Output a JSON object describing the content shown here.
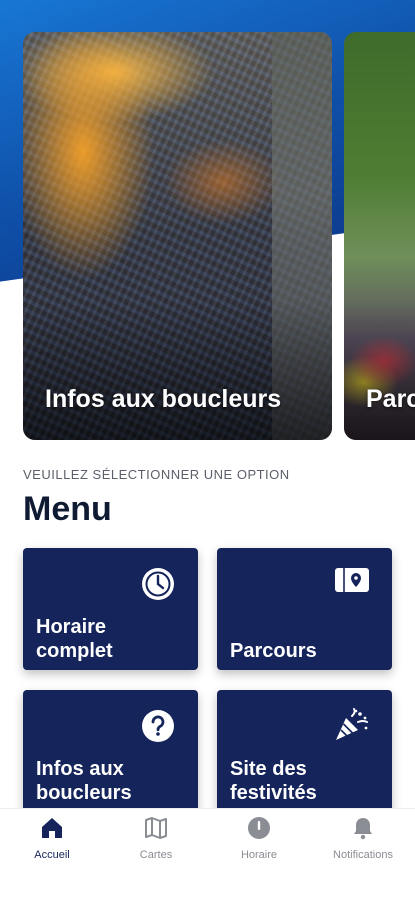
{
  "carousel": {
    "cards": [
      {
        "title": "Infos aux boucleurs"
      },
      {
        "title": "Parcours"
      }
    ]
  },
  "menu_section": {
    "subtitle": "VEUILLEZ SÉLECTIONNER UNE OPTION",
    "title": "Menu"
  },
  "tiles": [
    {
      "label": "Horaire complet",
      "icon": "clock-icon"
    },
    {
      "label": "Parcours",
      "icon": "map-pin-icon"
    },
    {
      "label": "Infos aux boucleurs",
      "icon": "question-icon"
    },
    {
      "label": "Site des festivités",
      "icon": "party-popper-icon"
    }
  ],
  "bottom_nav": {
    "items": [
      {
        "label": "Accueil",
        "icon": "home-icon",
        "active": true
      },
      {
        "label": "Cartes",
        "icon": "map-icon",
        "active": false
      },
      {
        "label": "Horaire",
        "icon": "info-icon",
        "active": false
      },
      {
        "label": "Notifications",
        "icon": "bell-icon",
        "active": false
      }
    ]
  },
  "colors": {
    "primary_navy": "#15245a",
    "header_blue": "#1877d4",
    "nav_inactive": "#8a8d94"
  }
}
